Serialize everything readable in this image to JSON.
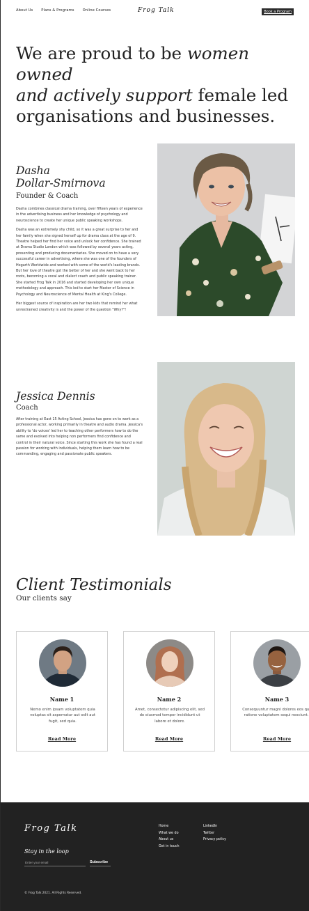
{
  "nav": {
    "items": [
      "About Us",
      "Plans & Programs",
      "Online Courses"
    ],
    "cta": "Book a Program"
  },
  "brand": {
    "logo": "Frog Talk"
  },
  "hero": {
    "line1": "We are proud to be ",
    "emph1": "women owned",
    "emph2": "and actively support",
    "line2": " female led",
    "line3": "organisations and businesses."
  },
  "team": [
    {
      "name_line1": "Dasha",
      "name_line2": "Dollar-Smirnova",
      "role": "Founder & Coach",
      "paragraphs": [
        "Dasha combines classical drama training, over fifteen years of experience in the advertising business and her knowledge of psychology and neuroscience to create her unique public speaking workshops.",
        "Dasha was an extremely shy child, so it was a great surprise to her and her family when she signed herself up for drama class at the age of 9. Theatre helped her find her voice and unlock her confidence. She trained at Drama Studio London which was followed by several years acting, presenting and producing documentaries. She moved on to have a very successful career in advertising, where she was one of the founders of Hogarth Worldwide and worked with some of the world's leading brands. But her love of theatre got the better of her and she went back to her roots, becoming a vocal and dialect coach and public speaking trainer. She started Frog Talk in 2016 and started developing her own unique methodology and approach. This led to start her Master of Science in Psychology and Neuroscience of Mental Health at King's College.",
        "Her biggest source of inspiration are her two kids that remind her what unrestrained creativity is and the power of the question \"Why?\"!"
      ]
    },
    {
      "name_line1": "Jessica Dennis",
      "role": "Coach",
      "paragraphs": [
        "After training at East 15 Acting School, Jessica has gone on to work as a professional actor, working primarily in theatre and audio drama. Jessica's ability to 'do voices' led her to teaching other performers how to do the same and evolved into helping non performers find confidence and control in their natural voice. Since starting this work she has found a real passion for working with individuals, helping them learn how to be commanding, engaging and passionate public speakers."
      ]
    }
  ],
  "testimonials": {
    "title": "Client Testimonials",
    "subtitle": "Our clients say",
    "cards": [
      {
        "name": "Name 1",
        "text": "Nemo enim ipsam voluptatem quia voluptas sit aspernatur aut odit aut fugit, sed quia.",
        "more": "Read More"
      },
      {
        "name": "Name 2",
        "text": "Amet, consectetur adipiscing elit, sed do eiusmod tempor incididunt ut labore et dolore.",
        "more": "Read More"
      },
      {
        "name": "Name 3",
        "text": "Consequuntur magni dolores eos qui ratione voluptatem sequi nesciunt.",
        "more": "Read More"
      }
    ]
  },
  "footer": {
    "logo": "Frog Talk",
    "stay": "Stay in the loop",
    "email_placeholder": "Enter your email",
    "subscribe": "Subscribe",
    "col1": [
      "Home",
      "What we do",
      "About us",
      "Get in touch"
    ],
    "col2": [
      "LinkedIn",
      "Twitter",
      "Privacy policy"
    ],
    "copyright": "© Frog Talk 2021. All Rights Reserved."
  },
  "colors": {
    "footer_bg": "#222222",
    "button_bg": "#2b2b2b",
    "card_border": "#cfcfcf"
  }
}
